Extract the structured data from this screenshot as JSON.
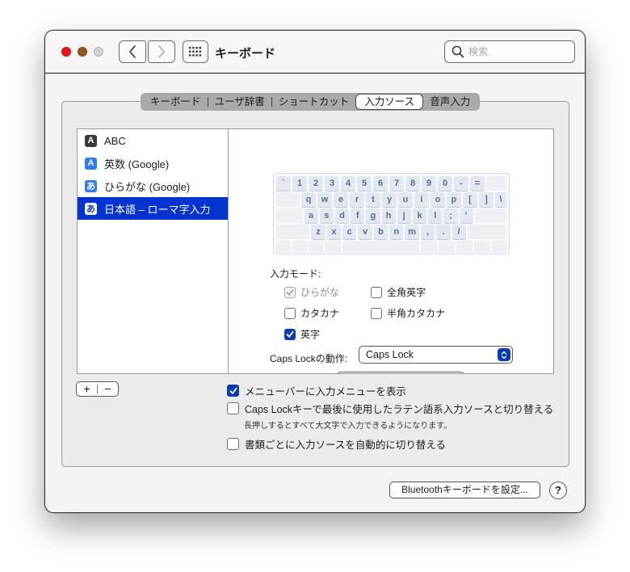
{
  "window": {
    "title": "キーボード",
    "search_placeholder": "検索",
    "icons": {
      "back": "chevron-left-icon",
      "forward": "chevron-right-icon",
      "grid": "show-all-grid-icon",
      "search": "magnifier-icon"
    }
  },
  "tabs": [
    {
      "label": "キーボード",
      "active": false
    },
    {
      "label": "ユーザ辞書",
      "active": false
    },
    {
      "label": "ショートカット",
      "active": false
    },
    {
      "label": "入力ソース",
      "active": true
    },
    {
      "label": "音声入力",
      "active": false
    }
  ],
  "sources": [
    {
      "icon_char": "A",
      "icon_style": "dark",
      "label": "ABC",
      "selected": false
    },
    {
      "icon_char": "A",
      "icon_style": "blue",
      "label": "英数 (Google)",
      "selected": false
    },
    {
      "icon_char": "あ",
      "icon_style": "blue",
      "label": "ひらがな (Google)",
      "selected": false
    },
    {
      "icon_char": "あ",
      "icon_style": "inverse",
      "label": "日本語 – ローマ字入力",
      "selected": true
    }
  ],
  "keyboard": {
    "rows": [
      [
        "`",
        "1",
        "2",
        "3",
        "4",
        "5",
        "6",
        "7",
        "8",
        "9",
        "0",
        "-",
        "=",
        ""
      ],
      [
        "",
        "q",
        "w",
        "e",
        "r",
        "t",
        "y",
        "u",
        "i",
        "o",
        "p",
        "[",
        "]",
        "\\"
      ],
      [
        "",
        "a",
        "s",
        "d",
        "f",
        "g",
        "h",
        "j",
        "k",
        "l",
        ";",
        "'",
        ""
      ],
      [
        "",
        "z",
        "x",
        "c",
        "v",
        "b",
        "n",
        "m",
        ",",
        ".",
        "/",
        ""
      ],
      [
        "",
        "",
        "",
        "",
        "",
        "",
        "",
        "",
        "",
        ""
      ]
    ]
  },
  "input_mode": {
    "label": "入力モード:",
    "options": [
      {
        "label": "ひらがな",
        "checked": true,
        "disabled": true
      },
      {
        "label": "全角英字",
        "checked": false,
        "disabled": false
      },
      {
        "label": "カタカナ",
        "checked": false,
        "disabled": false
      },
      {
        "label": "半角カタカナ",
        "checked": false,
        "disabled": false
      },
      {
        "label": "英字",
        "checked": true,
        "disabled": false
      }
    ]
  },
  "caps_lock": {
    "label": "Caps Lockの動作:",
    "value": "Caps Lock"
  },
  "list_controls": {
    "add": "+",
    "remove": "−"
  },
  "options": [
    {
      "label": "メニューバーに入力メニューを表示",
      "checked": true
    },
    {
      "label": "Caps Lockキーで最後に使用したラテン語系入力ソースと切り替える",
      "checked": false
    },
    {
      "label": "書類ごとに入力ソースを自動的に切り替える",
      "checked": false
    }
  ],
  "options_note": "長押しするとすべて大文字で入力できるようになります。",
  "footer": {
    "bluetooth_button": "Bluetoothキーボードを設定...",
    "help_button": "?"
  },
  "colors": {
    "selection": "#0433cf",
    "checkbox_checked": "#0a3bb0",
    "close": "#e8151b",
    "minimize": "#8f5a1e",
    "zoom": "#cfd1d4"
  }
}
